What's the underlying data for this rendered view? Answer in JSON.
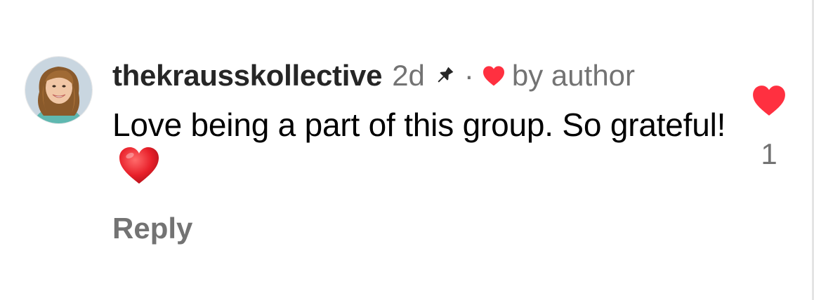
{
  "comment": {
    "username": "thekrausskollective",
    "time_ago": "2d",
    "separator": "·",
    "author_like_label": "by author",
    "text": "Love being a part of this group. So grateful!",
    "emoji": "heart-emoji",
    "reply_label": "Reply"
  },
  "like": {
    "count": "1",
    "liked": true
  },
  "icons": {
    "pin": "pin-icon",
    "small_heart": "heart-icon",
    "like": "heart-icon"
  },
  "colors": {
    "like_red": "#ff3040",
    "secondary_text": "#737373",
    "username_text": "#262626"
  }
}
